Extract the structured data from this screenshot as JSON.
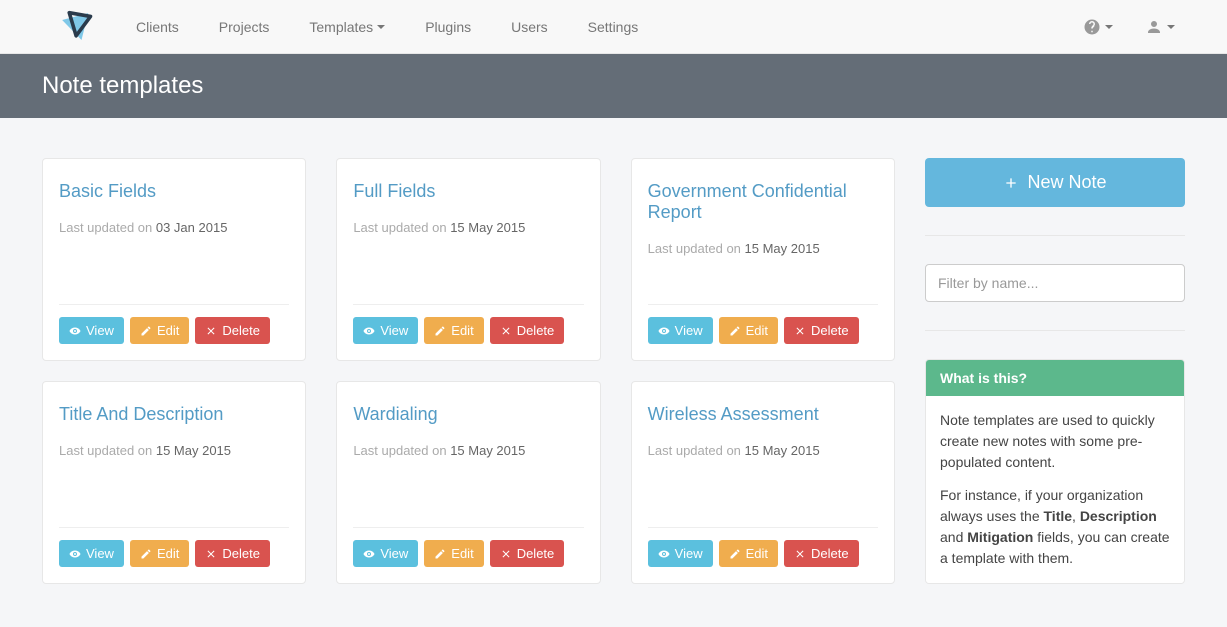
{
  "nav": {
    "clients": "Clients",
    "projects": "Projects",
    "templates": "Templates",
    "plugins": "Plugins",
    "users": "Users",
    "settings": "Settings"
  },
  "page_title": "Note templates",
  "last_updated_prefix": "Last updated on ",
  "buttons": {
    "view": "View",
    "edit": "Edit",
    "delete": "Delete",
    "new_note": "New Note"
  },
  "cards": [
    {
      "title": "Basic Fields",
      "date": "03 Jan 2015"
    },
    {
      "title": "Full Fields",
      "date": "15 May 2015"
    },
    {
      "title": "Government Confidential Report",
      "date": "15 May 2015"
    },
    {
      "title": "Title And Description",
      "date": "15 May 2015"
    },
    {
      "title": "Wardialing",
      "date": "15 May 2015"
    },
    {
      "title": "Wireless Assessment",
      "date": "15 May 2015"
    }
  ],
  "filter_placeholder": "Filter by name...",
  "help": {
    "heading": "What is this?",
    "p1": "Note templates are used to quickly create new notes with some pre-populated content.",
    "p2_a": "For instance, if your organization always uses the ",
    "p2_b1": "Title",
    "p2_c": ", ",
    "p2_b2": "Description",
    "p2_d": " and ",
    "p2_b3": "Mitigation",
    "p2_e": " fields, you can create a template with them."
  }
}
